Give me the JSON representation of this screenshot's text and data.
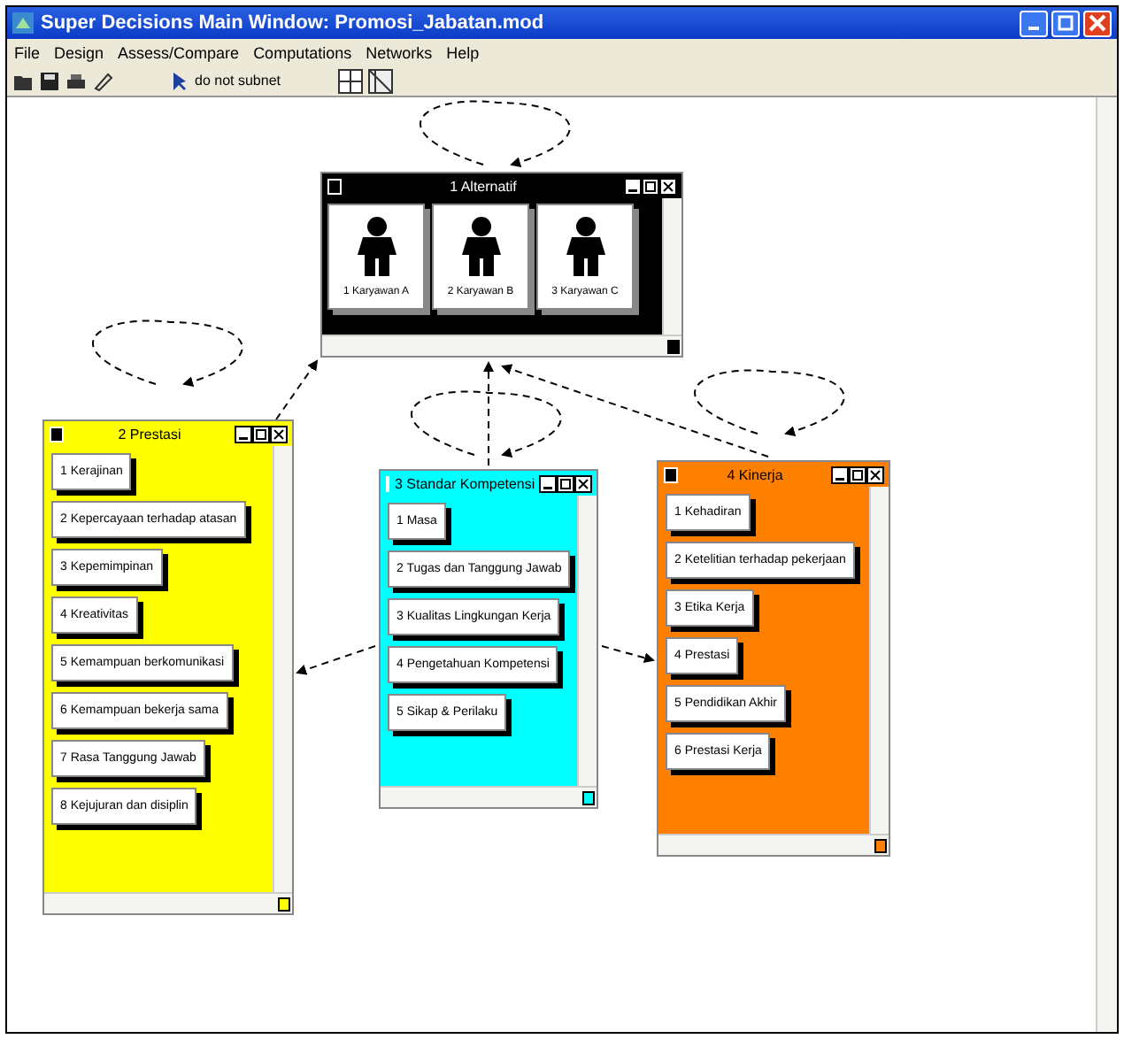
{
  "window": {
    "title": "Super Decisions Main Window: Promosi_Jabatan.mod"
  },
  "menu": [
    "File",
    "Design",
    "Assess/Compare",
    "Computations",
    "Networks",
    "Help"
  ],
  "toolbar": {
    "label": "do not subnet"
  },
  "clusters": [
    {
      "title": "1 Alternatif",
      "color": "#000000",
      "kind": "alternatives",
      "nodes": [
        "1 Karyawan A",
        "2 Karyawan B",
        "3 Karyawan C"
      ]
    },
    {
      "title": "2 Prestasi",
      "color": "#ffff00",
      "kind": "list",
      "nodes": [
        "1 Kerajinan",
        "2 Kepercayaan terhadap atasan",
        "3 Kepemimpinan",
        "4 Kreativitas",
        "5 Kemampuan berkomunikasi",
        "6 Kemampuan bekerja sama",
        "7 Rasa Tanggung Jawab",
        "8 Kejujuran dan disiplin"
      ]
    },
    {
      "title": "3 Standar Kompetensi",
      "color": "#00ffff",
      "kind": "list",
      "nodes": [
        "1 Masa",
        "2 Tugas dan Tanggung Jawab",
        "3 Kualitas Lingkungan Kerja",
        "4 Pengetahuan Kompetensi",
        "5 Sikap & Perilaku"
      ]
    },
    {
      "title": "4 Kinerja",
      "color": "#ff8000",
      "kind": "list",
      "nodes": [
        "1 Kehadiran",
        "2 Ketelitian terhadap pekerjaan",
        "3 Etika Kerja",
        "4 Prestasi",
        "5 Pendidikan Akhir",
        "6 Prestasi Kerja"
      ]
    }
  ]
}
